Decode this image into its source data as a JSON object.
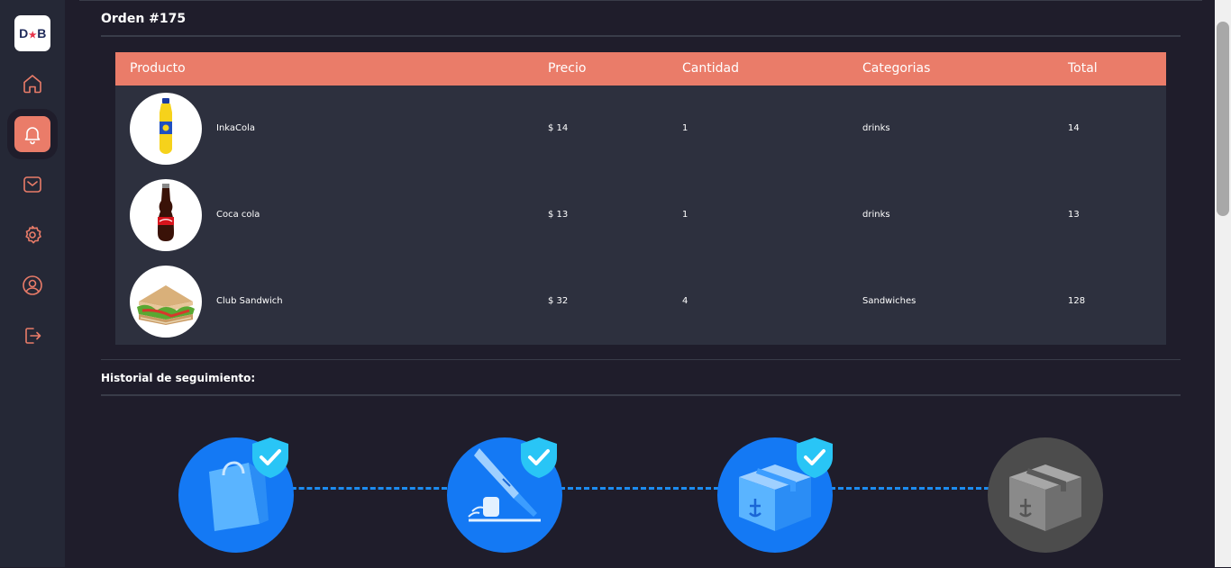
{
  "app": {
    "logo_text": "D★B"
  },
  "sidebar": {
    "items": [
      {
        "name": "home-icon",
        "active": false
      },
      {
        "name": "bell-icon",
        "active": true
      },
      {
        "name": "mail-icon",
        "active": false
      },
      {
        "name": "gear-icon",
        "active": false
      },
      {
        "name": "user-icon",
        "active": false
      },
      {
        "name": "logout-icon",
        "active": false
      }
    ]
  },
  "order": {
    "title": "Orden #175",
    "columns": [
      "Producto",
      "Precio",
      "Cantidad",
      "Categorias",
      "Total"
    ],
    "rows": [
      {
        "image": "inkacola-bottle",
        "product": "InkaCola",
        "price": "$ 14",
        "quantity": "1",
        "category": "drinks",
        "total": "14"
      },
      {
        "image": "cocacola-bottle",
        "product": "Coca cola",
        "price": "$ 13",
        "quantity": "1",
        "category": "drinks",
        "total": "13"
      },
      {
        "image": "club-sandwich",
        "product": "Club Sandwich",
        "price": "$ 32",
        "quantity": "4",
        "category": "Sandwiches",
        "total": "128"
      }
    ]
  },
  "tracking": {
    "title": "Historial de seguimiento:",
    "steps": [
      {
        "icon": "shopping-bag-icon",
        "status": "done"
      },
      {
        "icon": "kitchen-knife-icon",
        "status": "done"
      },
      {
        "icon": "package-icon",
        "status": "done"
      },
      {
        "icon": "package-icon",
        "status": "pending"
      }
    ]
  },
  "colors": {
    "accent": "#ea7c69",
    "background": "#1f1d2b",
    "panel": "#2d303e",
    "step_done": "#1479f4",
    "step_pending": "#4c4c4c",
    "check": "#29c5f6"
  }
}
